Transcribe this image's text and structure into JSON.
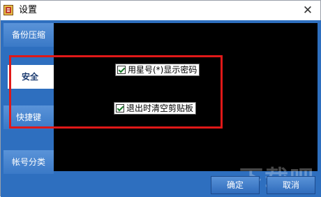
{
  "window": {
    "title": "设置",
    "close_symbol": "✕",
    "icon": "app-icon"
  },
  "sidebar": {
    "items": [
      {
        "label": "备份压缩",
        "selected": false
      },
      {
        "label": "安全",
        "selected": true
      },
      {
        "label": "快捷键",
        "selected": false
      },
      {
        "label": "帐号分类",
        "selected": false
      }
    ]
  },
  "options": [
    {
      "label": "用星号(*)显示密码",
      "checked": true
    },
    {
      "label": "退出时清空剪贴板",
      "checked": true
    }
  ],
  "buttons": {
    "ok": "确定",
    "cancel": "取消"
  },
  "watermark": "下载吧",
  "colors": {
    "accent_blue": "#2e6fbf",
    "panel_black": "#000000",
    "highlight_red": "#e01818"
  }
}
